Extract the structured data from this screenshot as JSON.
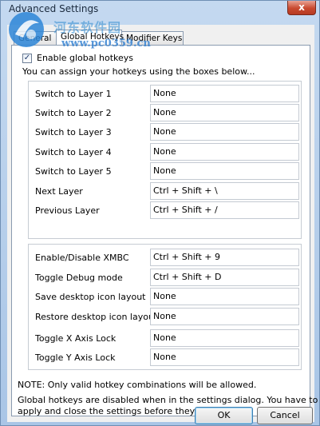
{
  "window": {
    "title": "Advanced Settings",
    "close_label": "x"
  },
  "watermark": {
    "text": "河东软件园",
    "url": "www.pc0359.cn"
  },
  "tabs": [
    {
      "label": "General"
    },
    {
      "label": "Global Hotkeys"
    },
    {
      "label": "Modifier Keys"
    }
  ],
  "enable_checkbox": {
    "label": "Enable global hotkeys",
    "checked": true
  },
  "intro_text": "You can assign your hotkeys using the boxes below...",
  "group1": [
    {
      "label": "Switch to Layer 1",
      "value": "None"
    },
    {
      "label": "Switch to Layer 2",
      "value": "None"
    },
    {
      "label": "Switch to Layer 3",
      "value": "None"
    },
    {
      "label": "Switch to Layer 4",
      "value": "None"
    },
    {
      "label": "Switch to Layer 5",
      "value": "None"
    },
    {
      "label": "Next Layer",
      "value": "Ctrl + Shift + \\"
    },
    {
      "label": "Previous Layer",
      "value": "Ctrl + Shift + /"
    }
  ],
  "group2": [
    {
      "label": "Enable/Disable XMBC",
      "value": "Ctrl + Shift + 9"
    },
    {
      "label": "Toggle Debug mode",
      "value": "Ctrl + Shift + D"
    },
    {
      "label": "Save desktop icon layout",
      "value": "None"
    },
    {
      "label": "Restore desktop icon layout",
      "value": "None"
    },
    {
      "label": "Toggle X Axis Lock",
      "value": "None"
    },
    {
      "label": "Toggle Y Axis Lock",
      "value": "None"
    }
  ],
  "note": "NOTE: Only valid hotkey combinations will be allowed.",
  "info_line1": "Global hotkeys are disabled when in the settings dialog. You have to",
  "info_line2": "apply and close the settings before they will work.",
  "buttons": {
    "ok": "OK",
    "cancel": "Cancel"
  }
}
